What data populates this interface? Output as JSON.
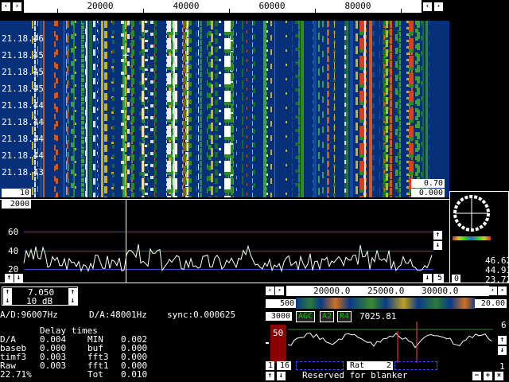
{
  "freq_scale": {
    "labels": [
      "20000",
      "40000",
      "60000",
      "80000"
    ]
  },
  "times": [
    "21.18.46",
    "21.18.45",
    "21.18.45",
    "21.18.45",
    "21.18.44",
    "21.18.44",
    "21.18.44",
    "21.18.44",
    "21.18.43"
  ],
  "waterfall": {
    "left_box": "10",
    "right_top": "0.70",
    "right_bottom": "0.000"
  },
  "spectrum": {
    "top_box": "2000",
    "y_labels": [
      "60",
      "40",
      "20"
    ],
    "right_box": "5"
  },
  "smeter": {
    "v1": "46.62",
    "v2": "44.91",
    "v3": "23.72",
    "zero": "0"
  },
  "controls": {
    "freq": "7.050",
    "db": "10 dB"
  },
  "status": {
    "ad": "A/D:96007Hz",
    "da": "D/A:48001Hz",
    "sync": "sync:0.000625",
    "delay_title": "Delay times",
    "rows": [
      {
        "a": "D/A",
        "b": "0.004",
        "c": "MIN",
        "d": "0.002"
      },
      {
        "a": "baseb",
        "b": "0.000",
        "c": "buf",
        "d": "0.000"
      },
      {
        "a": "timf3",
        "b": "0.003",
        "c": "fft3",
        "d": "0.000"
      },
      {
        "a": "Raw",
        "b": "0.003",
        "c": "fft1",
        "d": "0.000"
      },
      {
        "a": "22.71%",
        "b": "",
        "c": "Tot",
        "d": "0.010"
      }
    ]
  },
  "baseband": {
    "scale_labels": [
      "20000.0",
      "25000.0",
      "30000.0"
    ],
    "left_box": "500",
    "right_box": "20.00",
    "bw": "3000",
    "agc": "AGC",
    "a2": "A2",
    "r4": "R4",
    "freq": "7025.81",
    "level": "50",
    "right_top": "6",
    "right_bottom": "1",
    "btm_left": "1",
    "btm_16": "16",
    "rat_label": "Rat",
    "rat_val": "2",
    "blanker": "Reserved for blanker"
  },
  "colors": {
    "waterfall_bg": "#06307a",
    "trace": "#ffffff",
    "grid": "#2650c8",
    "level_bar": "#8b0000",
    "marker": "#ff4040"
  }
}
